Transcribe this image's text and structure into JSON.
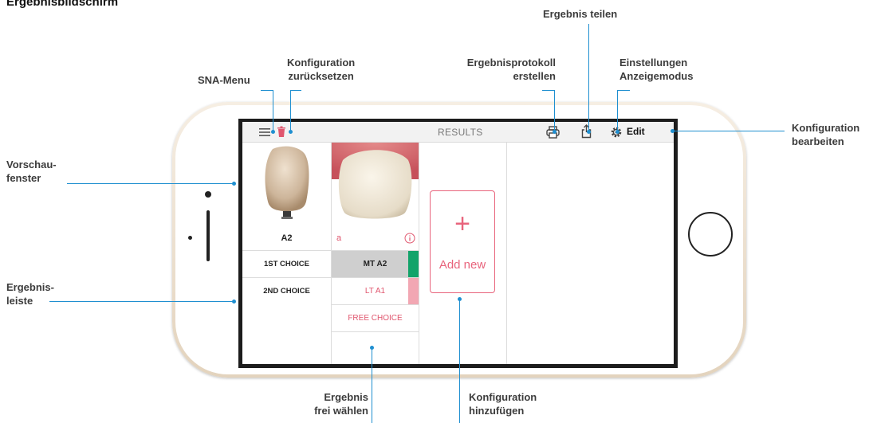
{
  "page_title": "Ergebnisbildschirm",
  "annotations": {
    "ergebnis_teilen": [
      "Ergebnis teilen"
    ],
    "sna_menu": [
      "SNA-Menu"
    ],
    "konfig_zuruecksetzen": [
      "Konfiguration",
      "zurücksetzen"
    ],
    "ergebnisprotokoll": [
      "Ergebnisprotokoll",
      "erstellen"
    ],
    "einstellungen": [
      "Einstellungen",
      "Anzeigemodus"
    ],
    "konfig_bearbeiten": [
      "Konfiguration",
      "bearbeiten"
    ],
    "vorschaufenster": [
      "Vorschau-",
      "fenster"
    ],
    "ergebnisleiste": [
      "Ergebnis-",
      "leiste"
    ],
    "ergebnis_frei": [
      "Ergebnis",
      "frei wählen"
    ],
    "konfig_hinzufuegen": [
      "Konfiguration",
      "hinzufügen"
    ]
  },
  "app": {
    "topbar": {
      "title": "RESULTS",
      "edit_label": "Edit"
    },
    "preview": {
      "shade_label": "A2",
      "live_label": "a"
    },
    "choices": {
      "first_label": "1ST CHOICE",
      "second_label": "2ND CHOICE",
      "first_value": "MT A2",
      "second_value": "LT A1",
      "free_choice": "FREE CHOICE"
    },
    "add_new": {
      "plus": "+",
      "label": "Add new"
    }
  },
  "colors": {
    "annotation_line": "#1f8fd0",
    "accent_pink": "#e0566e",
    "swatch_green": "#12a36a",
    "swatch_pink": "#f2a7b3"
  }
}
